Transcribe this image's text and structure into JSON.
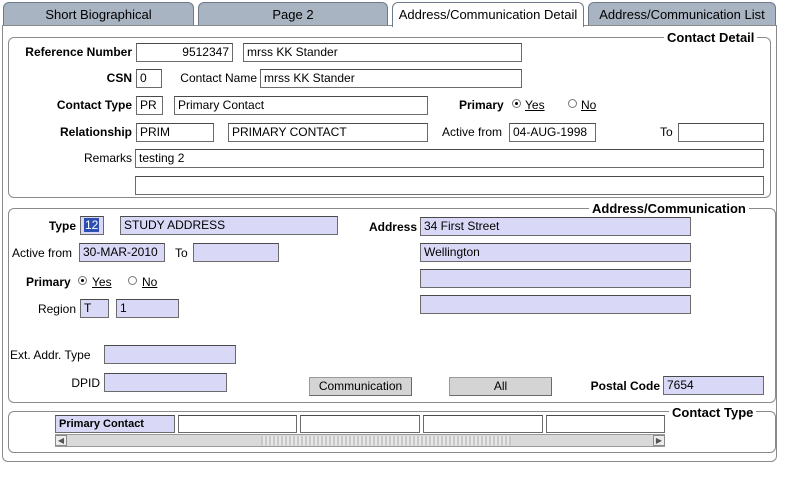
{
  "tabs": [
    {
      "label": "Short Biographical"
    },
    {
      "label": "Page 2"
    },
    {
      "label": "Address/Communication Detail"
    },
    {
      "label": "Address/Communication List"
    }
  ],
  "contact_detail": {
    "title": "Contact Detail",
    "reference_number_label": "Reference Number",
    "reference_number": "9512347",
    "reference_name": "mrss KK Stander",
    "csn_label": "CSN",
    "csn": "0",
    "contact_name_label": "Contact Name",
    "contact_name": "mrss KK Stander",
    "contact_type_label": "Contact Type",
    "contact_type_code": "PR",
    "contact_type_desc": "Primary Contact",
    "primary_label": "Primary",
    "yes_label": "Yes",
    "no_label": "No",
    "primary_value": "Yes",
    "relationship_label": "Relationship",
    "relationship_code": "PRIM",
    "relationship_desc": "PRIMARY CONTACT",
    "active_from_label": "Active from",
    "active_from": "04-AUG-1998",
    "to_label": "To",
    "to": "",
    "remarks_label": "Remarks",
    "remarks_1": "testing 2",
    "remarks_2": ""
  },
  "address": {
    "title": "Address/Communication",
    "type_label": "Type",
    "type_code": "12",
    "type_desc": "STUDY ADDRESS",
    "address_label": "Address",
    "address_lines": [
      "34 First Street",
      "Wellington",
      "",
      ""
    ],
    "active_from_label": "Active from",
    "active_from": "30-MAR-2010",
    "to_label": "To",
    "to": "",
    "primary_label": "Primary",
    "yes_label": "Yes",
    "no_label": "No",
    "primary_value": "Yes",
    "region_label": "Region",
    "region_code": "T",
    "region_value": "1",
    "ext_addr_type_label": "Ext. Addr. Type",
    "ext_addr_type": "",
    "dpid_label": "DPID",
    "dpid": "",
    "communication_button": "Communication",
    "all_button": "All",
    "postal_code_label": "Postal Code",
    "postal_code": "7654"
  },
  "contact_type_list": {
    "title": "Contact Type",
    "items": [
      "Primary Contact",
      "",
      "",
      "",
      ""
    ]
  }
}
